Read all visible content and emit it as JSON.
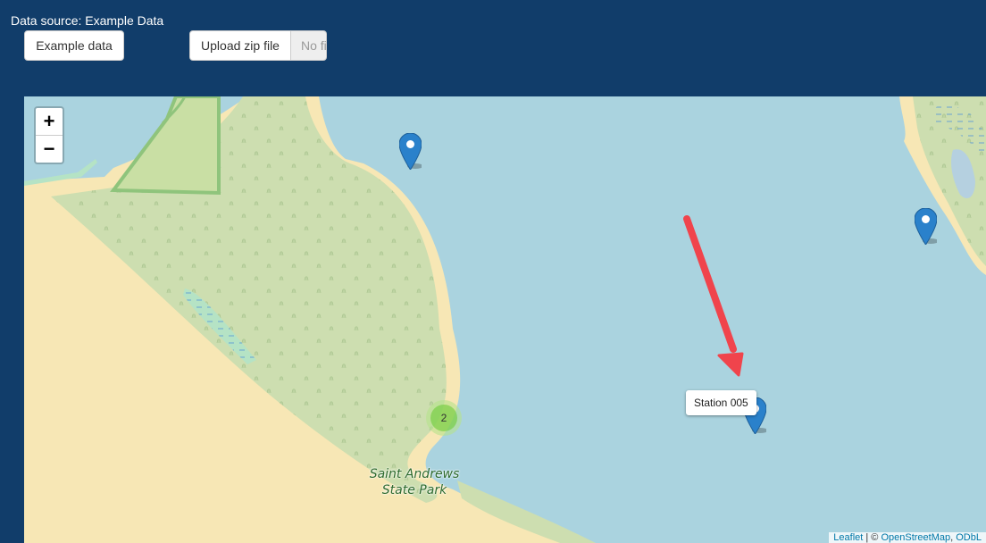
{
  "header": {
    "data_source_text": "Data source: Example Data",
    "example_button_label": "Example data",
    "upload_button_label": "Upload zip file",
    "file_name_text": "No file selected"
  },
  "map": {
    "zoom_in_label": "+",
    "zoom_out_label": "−",
    "cluster_count": "2",
    "tooltip_text": "Station 005",
    "park_label_line1": "Saint Andrews",
    "park_label_line2": "State Park",
    "attribution": {
      "leaflet": "Leaflet",
      "separator": " | © ",
      "osm": "OpenStreetMap",
      "odbl": "ODbL"
    },
    "marker_color": "#2a81cb",
    "water_color": "#aad3df",
    "land_color": "#cddeb0",
    "sand_color": "#f7e7b5",
    "arrow_color": "#f0444c"
  }
}
